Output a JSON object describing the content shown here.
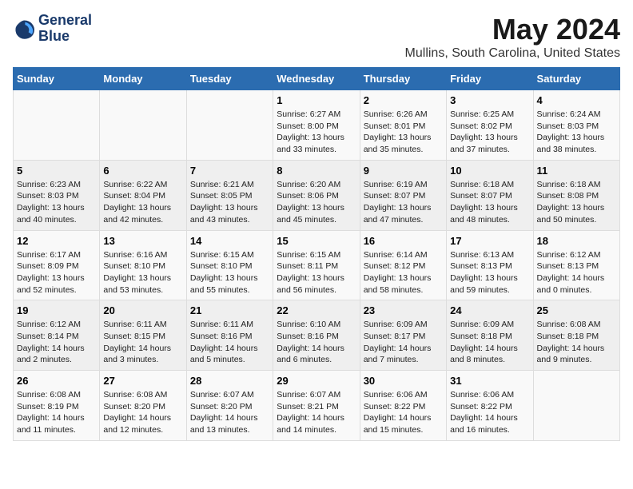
{
  "header": {
    "logo_line1": "General",
    "logo_line2": "Blue",
    "month": "May 2024",
    "location": "Mullins, South Carolina, United States"
  },
  "weekdays": [
    "Sunday",
    "Monday",
    "Tuesday",
    "Wednesday",
    "Thursday",
    "Friday",
    "Saturday"
  ],
  "weeks": [
    [
      {
        "day": "",
        "info": ""
      },
      {
        "day": "",
        "info": ""
      },
      {
        "day": "",
        "info": ""
      },
      {
        "day": "1",
        "info": "Sunrise: 6:27 AM\nSunset: 8:00 PM\nDaylight: 13 hours\nand 33 minutes."
      },
      {
        "day": "2",
        "info": "Sunrise: 6:26 AM\nSunset: 8:01 PM\nDaylight: 13 hours\nand 35 minutes."
      },
      {
        "day": "3",
        "info": "Sunrise: 6:25 AM\nSunset: 8:02 PM\nDaylight: 13 hours\nand 37 minutes."
      },
      {
        "day": "4",
        "info": "Sunrise: 6:24 AM\nSunset: 8:03 PM\nDaylight: 13 hours\nand 38 minutes."
      }
    ],
    [
      {
        "day": "5",
        "info": "Sunrise: 6:23 AM\nSunset: 8:03 PM\nDaylight: 13 hours\nand 40 minutes."
      },
      {
        "day": "6",
        "info": "Sunrise: 6:22 AM\nSunset: 8:04 PM\nDaylight: 13 hours\nand 42 minutes."
      },
      {
        "day": "7",
        "info": "Sunrise: 6:21 AM\nSunset: 8:05 PM\nDaylight: 13 hours\nand 43 minutes."
      },
      {
        "day": "8",
        "info": "Sunrise: 6:20 AM\nSunset: 8:06 PM\nDaylight: 13 hours\nand 45 minutes."
      },
      {
        "day": "9",
        "info": "Sunrise: 6:19 AM\nSunset: 8:07 PM\nDaylight: 13 hours\nand 47 minutes."
      },
      {
        "day": "10",
        "info": "Sunrise: 6:18 AM\nSunset: 8:07 PM\nDaylight: 13 hours\nand 48 minutes."
      },
      {
        "day": "11",
        "info": "Sunrise: 6:18 AM\nSunset: 8:08 PM\nDaylight: 13 hours\nand 50 minutes."
      }
    ],
    [
      {
        "day": "12",
        "info": "Sunrise: 6:17 AM\nSunset: 8:09 PM\nDaylight: 13 hours\nand 52 minutes."
      },
      {
        "day": "13",
        "info": "Sunrise: 6:16 AM\nSunset: 8:10 PM\nDaylight: 13 hours\nand 53 minutes."
      },
      {
        "day": "14",
        "info": "Sunrise: 6:15 AM\nSunset: 8:10 PM\nDaylight: 13 hours\nand 55 minutes."
      },
      {
        "day": "15",
        "info": "Sunrise: 6:15 AM\nSunset: 8:11 PM\nDaylight: 13 hours\nand 56 minutes."
      },
      {
        "day": "16",
        "info": "Sunrise: 6:14 AM\nSunset: 8:12 PM\nDaylight: 13 hours\nand 58 minutes."
      },
      {
        "day": "17",
        "info": "Sunrise: 6:13 AM\nSunset: 8:13 PM\nDaylight: 13 hours\nand 59 minutes."
      },
      {
        "day": "18",
        "info": "Sunrise: 6:12 AM\nSunset: 8:13 PM\nDaylight: 14 hours\nand 0 minutes."
      }
    ],
    [
      {
        "day": "19",
        "info": "Sunrise: 6:12 AM\nSunset: 8:14 PM\nDaylight: 14 hours\nand 2 minutes."
      },
      {
        "day": "20",
        "info": "Sunrise: 6:11 AM\nSunset: 8:15 PM\nDaylight: 14 hours\nand 3 minutes."
      },
      {
        "day": "21",
        "info": "Sunrise: 6:11 AM\nSunset: 8:16 PM\nDaylight: 14 hours\nand 5 minutes."
      },
      {
        "day": "22",
        "info": "Sunrise: 6:10 AM\nSunset: 8:16 PM\nDaylight: 14 hours\nand 6 minutes."
      },
      {
        "day": "23",
        "info": "Sunrise: 6:09 AM\nSunset: 8:17 PM\nDaylight: 14 hours\nand 7 minutes."
      },
      {
        "day": "24",
        "info": "Sunrise: 6:09 AM\nSunset: 8:18 PM\nDaylight: 14 hours\nand 8 minutes."
      },
      {
        "day": "25",
        "info": "Sunrise: 6:08 AM\nSunset: 8:18 PM\nDaylight: 14 hours\nand 9 minutes."
      }
    ],
    [
      {
        "day": "26",
        "info": "Sunrise: 6:08 AM\nSunset: 8:19 PM\nDaylight: 14 hours\nand 11 minutes."
      },
      {
        "day": "27",
        "info": "Sunrise: 6:08 AM\nSunset: 8:20 PM\nDaylight: 14 hours\nand 12 minutes."
      },
      {
        "day": "28",
        "info": "Sunrise: 6:07 AM\nSunset: 8:20 PM\nDaylight: 14 hours\nand 13 minutes."
      },
      {
        "day": "29",
        "info": "Sunrise: 6:07 AM\nSunset: 8:21 PM\nDaylight: 14 hours\nand 14 minutes."
      },
      {
        "day": "30",
        "info": "Sunrise: 6:06 AM\nSunset: 8:22 PM\nDaylight: 14 hours\nand 15 minutes."
      },
      {
        "day": "31",
        "info": "Sunrise: 6:06 AM\nSunset: 8:22 PM\nDaylight: 14 hours\nand 16 minutes."
      },
      {
        "day": "",
        "info": ""
      }
    ]
  ]
}
